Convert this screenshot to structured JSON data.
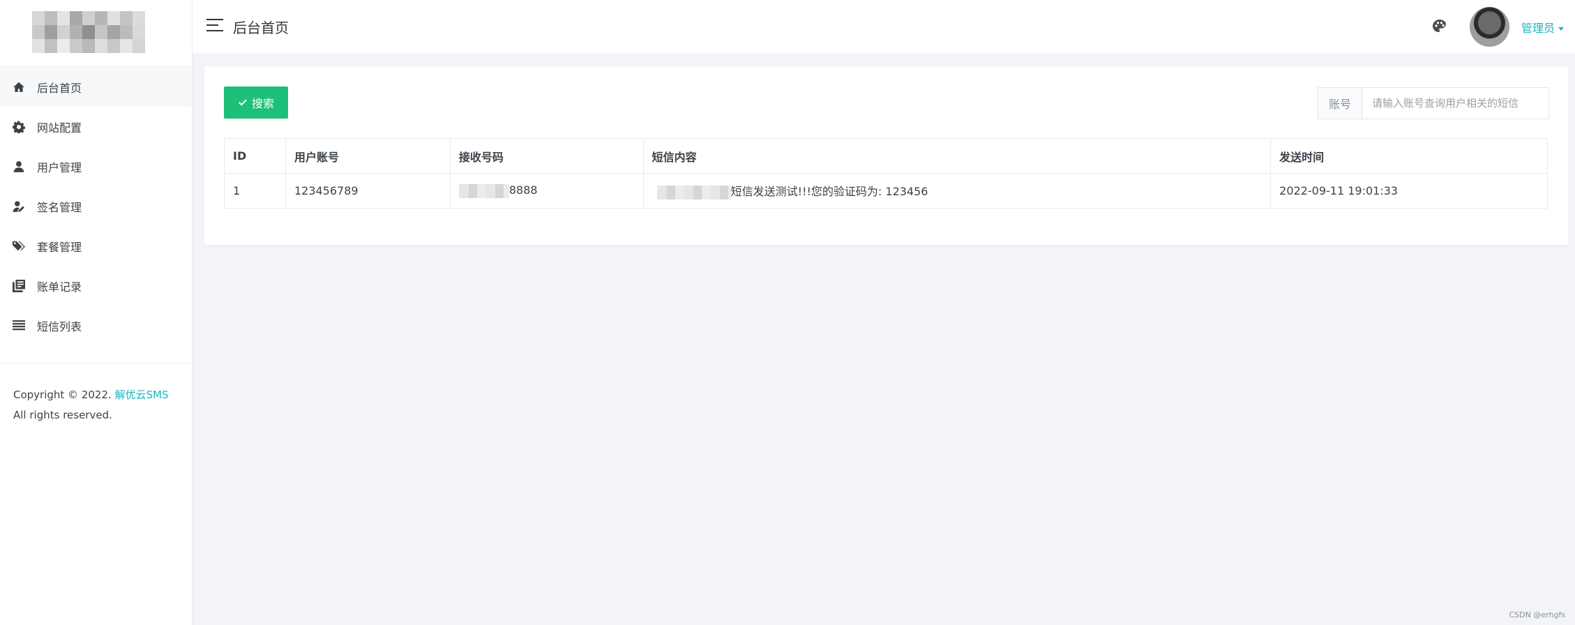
{
  "sidebar": {
    "items": [
      {
        "label": "后台首页",
        "icon": "home-icon"
      },
      {
        "label": "网站配置",
        "icon": "gear-icon"
      },
      {
        "label": "用户管理",
        "icon": "user-icon"
      },
      {
        "label": "签名管理",
        "icon": "user-edit-icon"
      },
      {
        "label": "套餐管理",
        "icon": "tags-icon"
      },
      {
        "label": "账单记录",
        "icon": "book-icon"
      },
      {
        "label": "短信列表",
        "icon": "list-icon"
      }
    ],
    "copyright_prefix": "Copyright © 2022.",
    "copyright_brand": "解优云SMS",
    "copyright_suffix": "All rights reserved."
  },
  "header": {
    "title": "后台首页",
    "user_name": "管理员"
  },
  "toolbar": {
    "search_label": "搜索",
    "field_label": "账号",
    "search_placeholder": "请输入账号查询用户相关的短信"
  },
  "table": {
    "columns": [
      "ID",
      "用户账号",
      "接收号码",
      "短信内容",
      "发送时间"
    ],
    "rows": [
      {
        "id": "1",
        "account": "123456789",
        "phone_visible": "8888",
        "content_visible": "短信发送测试!!!您的验证码为: 123456",
        "time": "2022-09-11 19:01:33"
      }
    ]
  },
  "watermark": "CSDN @erhgfs",
  "colors": {
    "accent": "#19b5c4",
    "button": "#1ebf79",
    "background": "#f3f4f8"
  }
}
